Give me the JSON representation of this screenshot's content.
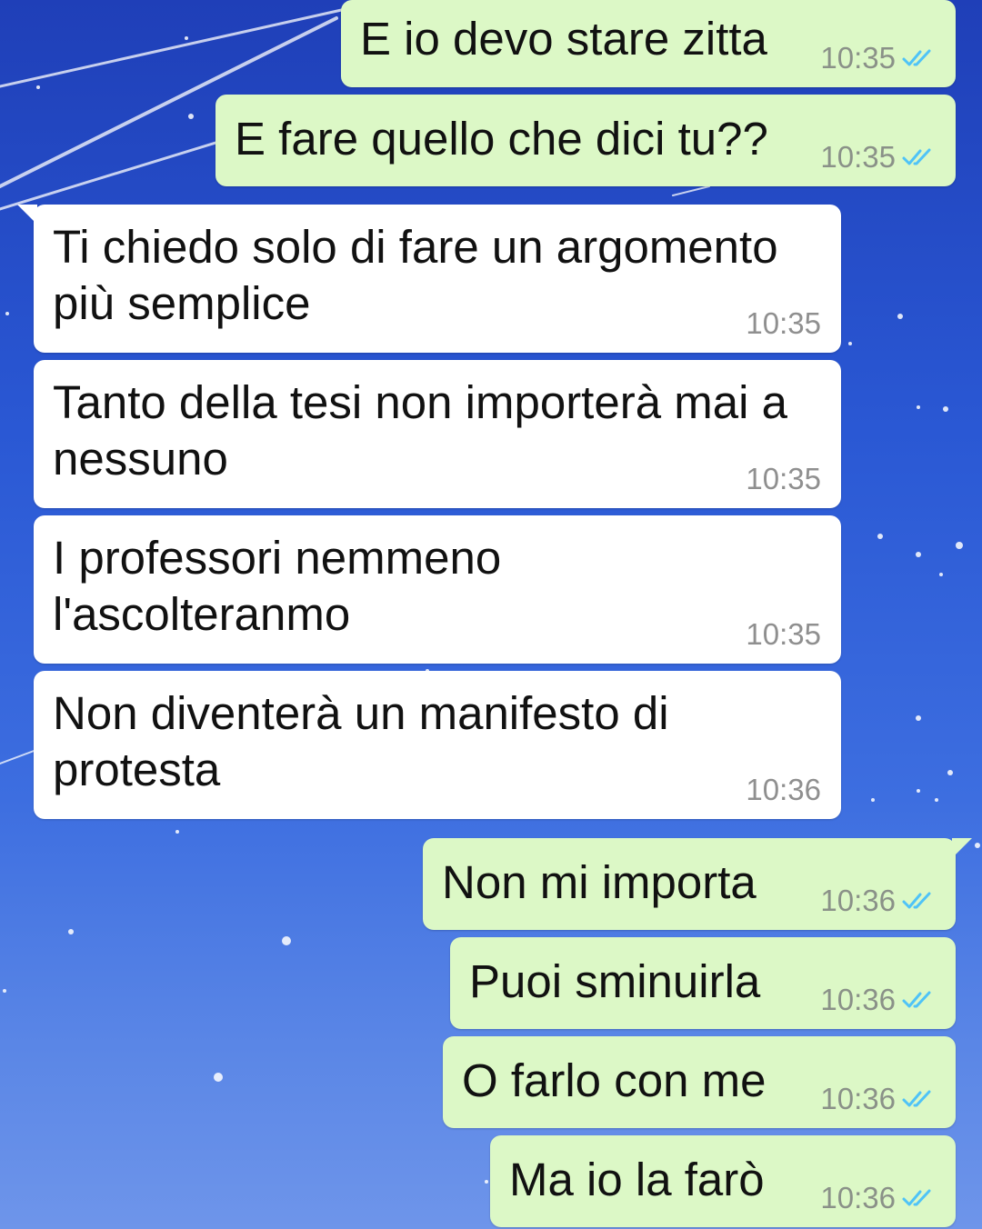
{
  "messages": [
    {
      "text": "E io devo stare zitta",
      "time": "10:35",
      "status": "read"
    },
    {
      "text": "E fare quello che dici tu??",
      "time": "10:35",
      "status": "read"
    },
    {
      "text": "Ti chiedo solo di fare un argomento più semplice",
      "time": "10:35"
    },
    {
      "text": "Tanto della tesi non importerà mai a nessuno",
      "time": "10:35"
    },
    {
      "text": "I professori nemmeno l'ascolteranmo",
      "time": "10:35"
    },
    {
      "text": "Non diventerà un manifesto di protesta",
      "time": "10:36"
    },
    {
      "text": "Non mi importa",
      "time": "10:36",
      "status": "read"
    },
    {
      "text": "Puoi sminuirla",
      "time": "10:36",
      "status": "read"
    },
    {
      "text": "O farlo con me",
      "time": "10:36",
      "status": "read"
    },
    {
      "text": "Ma io la farò",
      "time": "10:36",
      "status": "read"
    }
  ],
  "colors": {
    "outgoing_bubble": "#dcf8c6",
    "incoming_bubble": "#ffffff",
    "read_ticks": "#4fc3f7",
    "background_top": "#1f3fb8",
    "background_bottom": "#6e95ea"
  },
  "icons": {
    "read_receipt": "double-check-icon",
    "wallpaper": "starry-sky-wallpaper"
  }
}
